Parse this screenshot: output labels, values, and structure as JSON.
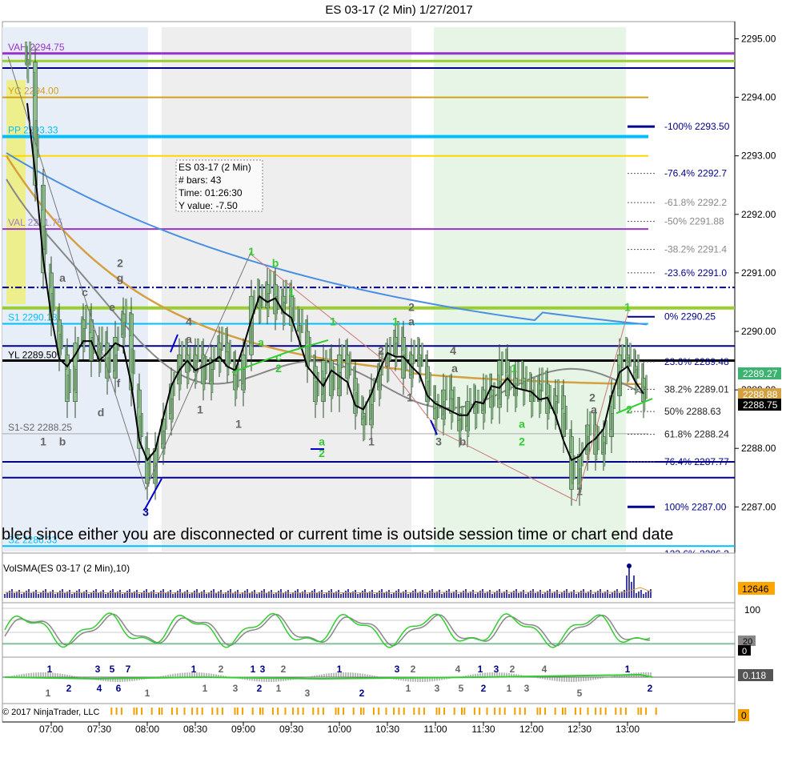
{
  "window": {
    "title": "ES 03-17 (2 Min)  1/27/2017",
    "copyright": "© 2017 NinjaTrader, LLC",
    "banner": "bled since either you are disconnected or current time is outside session time or chart end date"
  },
  "colors": {
    "background": "#ffffff",
    "bar_body": "#8fbf8f",
    "bar_wick": "#2f4f2f",
    "vah_line": "#9932cc",
    "green_level": "#9acd32",
    "navy_level": "#00008b",
    "yc_line": "#d4a017",
    "pp_line": "#00bfff",
    "gold_line": "#ffd700",
    "sma_black": "#000000",
    "sma_gray": "#888888",
    "sma_orange": "#d4a040",
    "sma_blue": "#4a90e2",
    "lime": "#32cd32",
    "price_box_green": "#3cb371",
    "price_box_black": "#000000",
    "volume_bar": "#00008b",
    "volume_label_bg": "#ffa500",
    "session_light_blue": "#e8eef8",
    "session_light_gray": "#eeeeee",
    "session_light_green": "#e6f5e6"
  },
  "chart_data": [
    {
      "type": "candlestick",
      "title": "ES 03-17 (2 Min)  1/27/2017",
      "ylim": [
        2286.25,
        2295.3
      ],
      "y_ticks": [
        "2295.00",
        "2294.00",
        "2293.00",
        "2292.00",
        "2291.00",
        "2290.00",
        "2289.00",
        "2288.00",
        "2287.00"
      ],
      "x_ticks": [
        "07:00",
        "07:30",
        "08:00",
        "08:30",
        "09:00",
        "09:30",
        "10:00",
        "10:30",
        "11:00",
        "11:30",
        "12:00",
        "12:30",
        "13:00"
      ],
      "levels": [
        {
          "label": "VAH 2294.75",
          "value": 2294.75,
          "color": "#9932cc"
        },
        {
          "label": "YC 2294.00",
          "value": 2294.0,
          "color": "#d4a017"
        },
        {
          "label": "PP 2293.33",
          "value": 2293.33,
          "color": "#00bfff"
        },
        {
          "label": "S1 2290.13",
          "value": 2290.13,
          "color": "#00bfff"
        },
        {
          "label": "YL 2289.50",
          "value": 2289.5,
          "color": "#000000"
        },
        {
          "label": "S1-S2 2288.25",
          "value": 2288.25,
          "color": "#888888"
        },
        {
          "label": "S2 2286.33",
          "value": 2286.33,
          "color": "#00bfff"
        }
      ],
      "fib_labels": [
        {
          "label": "-100%  2293.50",
          "value": 2293.5
        },
        {
          "label": "-76.4%  2292.7",
          "value": 2292.7
        },
        {
          "label": "-61.8%  2292.2",
          "value": 2292.2
        },
        {
          "label": "-50%  2291.88",
          "value": 2291.88
        },
        {
          "label": "-38.2%  2291.4",
          "value": 2291.4
        },
        {
          "label": "-23.6%  2291.0",
          "value": 2291.0
        },
        {
          "label": "0%  2290.25",
          "value": 2290.25
        },
        {
          "label": "23.6%  2289.48",
          "value": 2289.48
        },
        {
          "label": "38.2%  2289.01",
          "value": 2289.01
        },
        {
          "label": "50%  2288.63",
          "value": 2288.63
        },
        {
          "label": "61.8%  2288.24",
          "value": 2288.24
        },
        {
          "label": "76.4%  2287.77",
          "value": 2287.77
        },
        {
          "label": "100%  2287.00",
          "value": 2287.0
        },
        {
          "label": "123.6%  2286.2",
          "value": 2286.2
        }
      ],
      "tooltip": {
        "lines": [
          "ES 03-17 (2 Min)",
          "# bars:    43",
          "Time:      01:26:30",
          "Y value:  -7.50"
        ]
      },
      "price_tags": [
        {
          "label": "2289.27",
          "value": 2289.27,
          "color": "#3cb371"
        },
        {
          "label": "2288.88",
          "value": 2288.95,
          "color": "#d4a040"
        },
        {
          "label": "2288.75",
          "value": 2288.75,
          "color": "#000000"
        }
      ],
      "close_path": [
        [
          "06:45",
          2294.6
        ],
        [
          "06:50",
          2292.5
        ],
        [
          "06:55",
          2291.0
        ],
        [
          "07:00",
          2290.2
        ],
        [
          "07:05",
          2289.6
        ],
        [
          "07:10",
          2288.8
        ],
        [
          "07:15",
          2289.8
        ],
        [
          "07:20",
          2290.2
        ],
        [
          "07:25",
          2289.5
        ],
        [
          "07:30",
          2289.8
        ],
        [
          "07:35",
          2289.2
        ],
        [
          "07:40",
          2289.9
        ],
        [
          "07:45",
          2290.3
        ],
        [
          "07:50",
          2289.0
        ],
        [
          "07:55",
          2288.0
        ],
        [
          "08:00",
          2287.4
        ],
        [
          "08:05",
          2288.0
        ],
        [
          "08:10",
          2288.5
        ],
        [
          "08:15",
          2289.1
        ],
        [
          "08:20",
          2289.6
        ],
        [
          "08:25",
          2289.3
        ],
        [
          "08:30",
          2289.6
        ],
        [
          "08:35",
          2289.1
        ],
        [
          "08:40",
          2289.5
        ],
        [
          "08:45",
          2289.8
        ],
        [
          "08:50",
          2289.4
        ],
        [
          "08:55",
          2289.0
        ],
        [
          "09:00",
          2289.6
        ],
        [
          "09:05",
          2290.6
        ],
        [
          "09:10",
          2290.4
        ],
        [
          "09:15",
          2290.8
        ],
        [
          "09:20",
          2290.3
        ],
        [
          "09:25",
          2290.6
        ],
        [
          "09:30",
          2290.1
        ],
        [
          "09:35",
          2290.0
        ],
        [
          "09:40",
          2289.4
        ],
        [
          "09:45",
          2288.8
        ],
        [
          "09:50",
          2289.5
        ],
        [
          "09:55",
          2288.9
        ],
        [
          "10:00",
          2289.6
        ],
        [
          "10:05",
          2289.2
        ],
        [
          "10:10",
          2288.6
        ],
        [
          "10:15",
          2288.4
        ],
        [
          "10:20",
          2289.0
        ],
        [
          "10:25",
          2289.4
        ],
        [
          "10:30",
          2289.6
        ],
        [
          "10:35",
          2289.9
        ],
        [
          "10:40",
          2289.2
        ],
        [
          "10:45",
          2289.6
        ],
        [
          "10:50",
          2289.4
        ],
        [
          "10:55",
          2288.8
        ],
        [
          "11:00",
          2288.5
        ],
        [
          "11:05",
          2289.0
        ],
        [
          "11:10",
          2288.6
        ],
        [
          "11:15",
          2288.3
        ],
        [
          "11:20",
          2288.8
        ],
        [
          "11:25",
          2288.6
        ],
        [
          "11:30",
          2289.0
        ],
        [
          "11:35",
          2288.7
        ],
        [
          "11:40",
          2289.5
        ],
        [
          "11:45",
          2288.9
        ],
        [
          "11:50",
          2289.2
        ],
        [
          "11:55",
          2289.0
        ],
        [
          "12:00",
          2288.8
        ],
        [
          "12:05",
          2289.1
        ],
        [
          "12:10",
          2288.6
        ],
        [
          "12:15",
          2288.9
        ],
        [
          "12:20",
          2288.2
        ],
        [
          "12:25",
          2287.3
        ],
        [
          "12:30",
          2287.9
        ],
        [
          "12:35",
          2288.4
        ],
        [
          "12:40",
          2287.9
        ],
        [
          "12:45",
          2288.2
        ],
        [
          "12:50",
          2288.9
        ],
        [
          "12:55",
          2289.6
        ],
        [
          "13:00",
          2289.4
        ],
        [
          "13:05",
          2289.2
        ],
        [
          "13:10",
          2288.8
        ]
      ],
      "swing_labels": [
        {
          "label": "1",
          "time": "06:55",
          "value": 2288.05,
          "color": "#666666"
        },
        {
          "label": "b",
          "time": "07:07",
          "value": 2288.05,
          "color": "#666666"
        },
        {
          "label": "a",
          "time": "07:07",
          "value": 2290.85,
          "color": "#666666"
        },
        {
          "label": "c",
          "time": "07:21",
          "value": 2290.6,
          "color": "#666666"
        },
        {
          "label": "d",
          "time": "07:31",
          "value": 2288.55,
          "color": "#666666"
        },
        {
          "label": "e",
          "time": "07:38",
          "value": 2290.35,
          "color": "#666666"
        },
        {
          "label": "f",
          "time": "07:42",
          "value": 2289.05,
          "color": "#666666"
        },
        {
          "label": "2",
          "time": "07:43",
          "value": 2291.1,
          "color": "#666666"
        },
        {
          "label": "g",
          "time": "07:43",
          "value": 2290.85,
          "color": "#666666"
        },
        {
          "label": "3",
          "time": "07:59",
          "value": 2286.85,
          "color": "#00008b"
        },
        {
          "label": "4",
          "time": "08:26",
          "value": 2290.1,
          "color": "#666666"
        },
        {
          "label": "a",
          "time": "08:26",
          "value": 2289.8,
          "color": "#666666"
        },
        {
          "label": "1",
          "time": "08:33",
          "value": 2288.6,
          "color": "#666666"
        },
        {
          "label": "1",
          "time": "08:57",
          "value": 2288.35,
          "color": "#666666"
        },
        {
          "label": "1",
          "time": "09:05",
          "value": 2291.3,
          "color": "#32cd32"
        },
        {
          "label": "b",
          "time": "09:20",
          "value": 2291.1,
          "color": "#32cd32"
        },
        {
          "label": "a",
          "time": "09:11",
          "value": 2289.75,
          "color": "#32cd32"
        },
        {
          "label": "c",
          "time": "09:22",
          "value": 2289.5,
          "color": "#32cd32"
        },
        {
          "label": "2",
          "time": "09:22",
          "value": 2289.3,
          "color": "#32cd32"
        },
        {
          "label": "1",
          "time": "09:30",
          "value": 2290.6,
          "color": "#32cd32"
        },
        {
          "label": "1",
          "time": "09:56",
          "value": 2290.1,
          "color": "#32cd32"
        },
        {
          "label": "a",
          "time": "09:49",
          "value": 2288.05,
          "color": "#32cd32"
        },
        {
          "label": "2",
          "time": "09:49",
          "value": 2287.85,
          "color": "#32cd32"
        },
        {
          "label": "1",
          "time": "10:20",
          "value": 2288.05,
          "color": "#666666"
        },
        {
          "label": "2",
          "time": "10:26",
          "value": 2289.6,
          "color": "#666666"
        },
        {
          "label": "1",
          "time": "10:35",
          "value": 2290.1,
          "color": "#32cd32"
        },
        {
          "label": "2",
          "time": "10:45",
          "value": 2290.35,
          "color": "#666666"
        },
        {
          "label": "a",
          "time": "10:45",
          "value": 2290.1,
          "color": "#666666"
        },
        {
          "label": "1",
          "time": "10:44",
          "value": 2288.8,
          "color": "#666666"
        },
        {
          "label": "3",
          "time": "11:02",
          "value": 2288.05,
          "color": "#666666"
        },
        {
          "label": "4",
          "time": "11:11",
          "value": 2289.6,
          "color": "#666666"
        },
        {
          "label": "b",
          "time": "11:17",
          "value": 2288.05,
          "color": "#666666"
        },
        {
          "label": "a",
          "time": "11:12",
          "value": 2289.3,
          "color": "#666666"
        },
        {
          "label": "1",
          "time": "11:49",
          "value": 2289.3,
          "color": "#32cd32"
        },
        {
          "label": "a",
          "time": "11:54",
          "value": 2288.35,
          "color": "#32cd32"
        },
        {
          "label": "2",
          "time": "11:54",
          "value": 2288.05,
          "color": "#32cd32"
        },
        {
          "label": "1",
          "time": "12:30",
          "value": 2287.2,
          "color": "#666666"
        },
        {
          "label": "2",
          "time": "12:38",
          "value": 2288.8,
          "color": "#666666"
        },
        {
          "label": "a",
          "time": "12:39",
          "value": 2288.6,
          "color": "#666666"
        },
        {
          "label": "1",
          "time": "13:00",
          "value": 2290.35,
          "color": "#32cd32"
        },
        {
          "label": "2",
          "time": "13:01",
          "value": 2288.6,
          "color": "#32cd32"
        }
      ]
    },
    {
      "type": "bar",
      "title": "VolSMA(ES 03-17 (2 Min),10)",
      "last_value_label": "12646"
    },
    {
      "type": "line",
      "title": "",
      "y_tick_labels": [
        "100",
        "20",
        "0"
      ]
    },
    {
      "type": "bar",
      "title": "",
      "last_value_label": "0.118",
      "wave_labels": [
        {
          "label": "1",
          "time": "06:59",
          "row": "top",
          "color": "#00008b"
        },
        {
          "label": "2",
          "time": "07:11",
          "row": "bottom",
          "color": "#00008b"
        },
        {
          "label": "1",
          "time": "06:58",
          "row": "bottom2",
          "color": "#666666"
        },
        {
          "label": "3",
          "time": "07:29",
          "row": "top",
          "color": "#00008b"
        },
        {
          "label": "4",
          "time": "07:30",
          "row": "bottom",
          "color": "#00008b"
        },
        {
          "label": "5",
          "time": "07:38",
          "row": "top",
          "color": "#00008b"
        },
        {
          "label": "6",
          "time": "07:42",
          "row": "bottom",
          "color": "#00008b"
        },
        {
          "label": "7",
          "time": "07:48",
          "row": "top",
          "color": "#00008b"
        },
        {
          "label": "1",
          "time": "08:00",
          "row": "bottom2",
          "color": "#666666"
        },
        {
          "label": "1",
          "time": "08:29",
          "row": "top",
          "color": "#00008b"
        },
        {
          "label": "2",
          "time": "08:46",
          "row": "top",
          "color": "#666666"
        },
        {
          "label": "1",
          "time": "08:36",
          "row": "bottom",
          "color": "#666666"
        },
        {
          "label": "3",
          "time": "08:55",
          "row": "bottom",
          "color": "#666666"
        },
        {
          "label": "1",
          "time": "09:06",
          "row": "top",
          "color": "#00008b"
        },
        {
          "label": "3",
          "time": "09:12",
          "row": "top",
          "color": "#00008b"
        },
        {
          "label": "2",
          "time": "09:25",
          "row": "top",
          "color": "#666666"
        },
        {
          "label": "2",
          "time": "09:10",
          "row": "bottom",
          "color": "#00008b"
        },
        {
          "label": "1",
          "time": "09:22",
          "row": "bottom",
          "color": "#666666"
        },
        {
          "label": "1",
          "time": "10:00",
          "row": "top",
          "color": "#00008b"
        },
        {
          "label": "3",
          "time": "09:40",
          "row": "bottom2",
          "color": "#666666"
        },
        {
          "label": "2",
          "time": "10:14",
          "row": "bottom2",
          "color": "#00008b"
        },
        {
          "label": "3",
          "time": "10:36",
          "row": "top",
          "color": "#00008b"
        },
        {
          "label": "2",
          "time": "10:46",
          "row": "top",
          "color": "#666666"
        },
        {
          "label": "1",
          "time": "10:43",
          "row": "bottom",
          "color": "#666666"
        },
        {
          "label": "3",
          "time": "11:01",
          "row": "bottom",
          "color": "#666666"
        },
        {
          "label": "4",
          "time": "11:14",
          "row": "top",
          "color": "#666666"
        },
        {
          "label": "5",
          "time": "11:16",
          "row": "bottom",
          "color": "#666666"
        },
        {
          "label": "1",
          "time": "11:28",
          "row": "top",
          "color": "#00008b"
        },
        {
          "label": "2",
          "time": "11:30",
          "row": "bottom",
          "color": "#00008b"
        },
        {
          "label": "3",
          "time": "11:38",
          "row": "top",
          "color": "#00008b"
        },
        {
          "label": "2",
          "time": "11:48",
          "row": "top",
          "color": "#666666"
        },
        {
          "label": "1",
          "time": "11:46",
          "row": "bottom",
          "color": "#666666"
        },
        {
          "label": "3",
          "time": "11:57",
          "row": "bottom",
          "color": "#666666"
        },
        {
          "label": "4",
          "time": "12:08",
          "row": "top",
          "color": "#666666"
        },
        {
          "label": "5",
          "time": "12:30",
          "row": "bottom2",
          "color": "#666666"
        },
        {
          "label": "1",
          "time": "13:00",
          "row": "top",
          "color": "#00008b"
        },
        {
          "label": "2",
          "time": "13:14",
          "row": "bottom",
          "color": "#00008b"
        }
      ]
    },
    {
      "type": "bar",
      "title": "",
      "last_value_label": "0"
    }
  ]
}
